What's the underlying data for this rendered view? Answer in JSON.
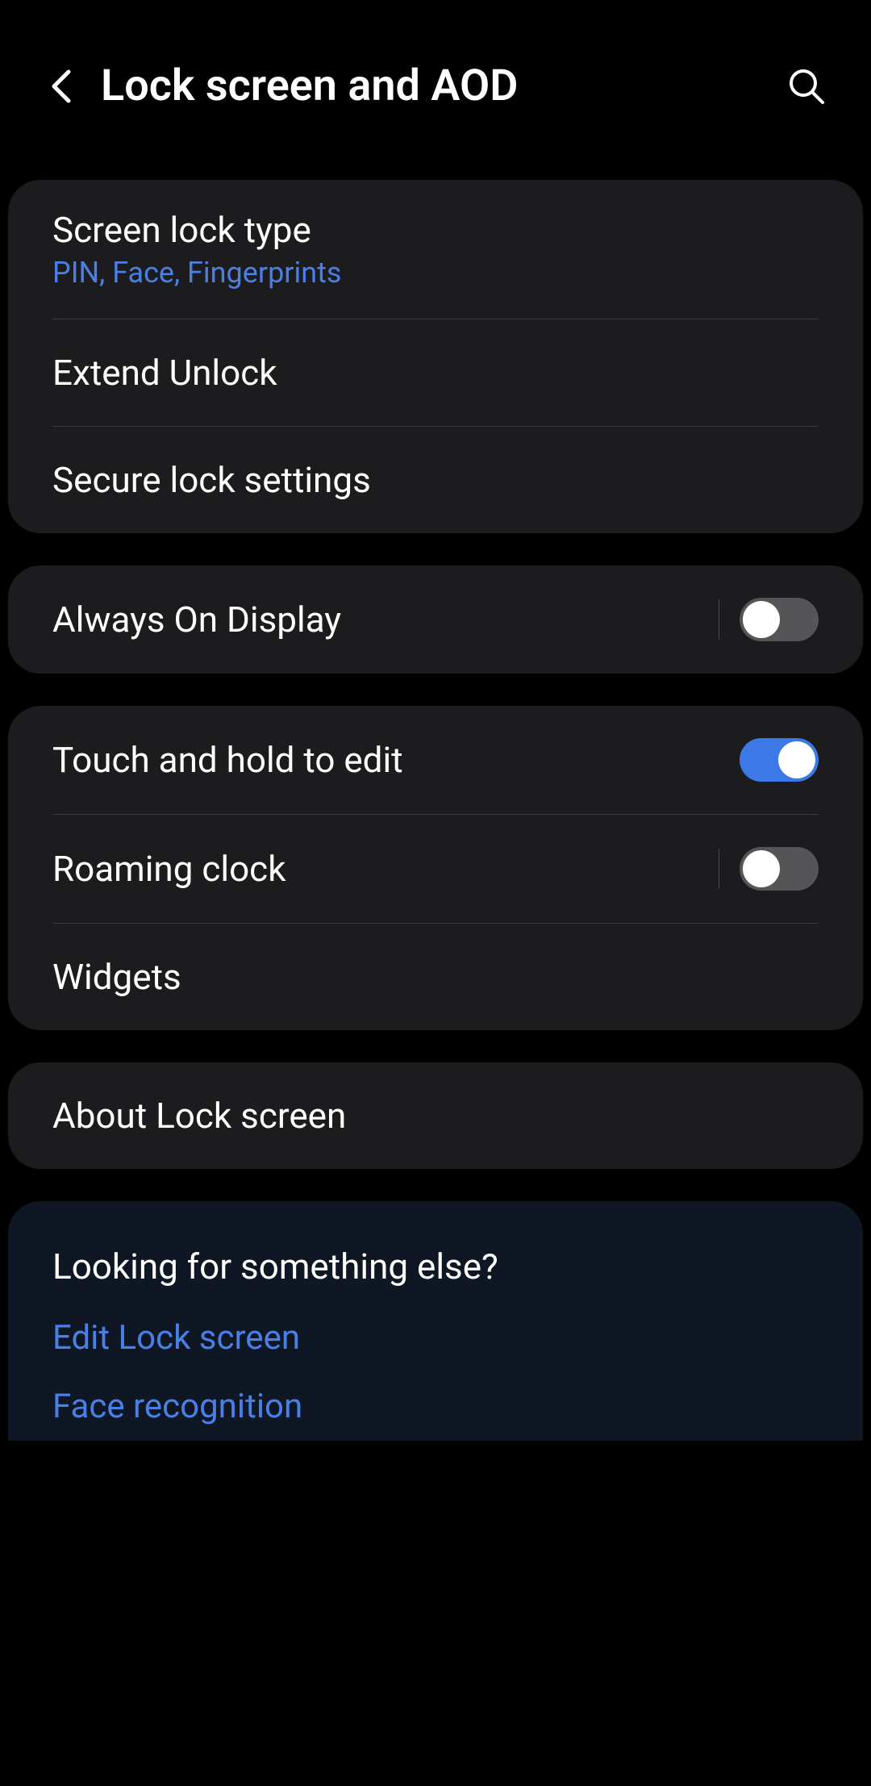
{
  "header": {
    "title": "Lock screen and AOD"
  },
  "group1": {
    "screen_lock_type": {
      "title": "Screen lock type",
      "subtitle": "PIN, Face, Fingerprints"
    },
    "extend_unlock": {
      "title": "Extend Unlock"
    },
    "secure_lock": {
      "title": "Secure lock settings"
    }
  },
  "group2": {
    "aod": {
      "title": "Always On Display",
      "enabled": false
    }
  },
  "group3": {
    "touch_hold": {
      "title": "Touch and hold to edit",
      "enabled": true
    },
    "roaming_clock": {
      "title": "Roaming clock",
      "enabled": false
    },
    "widgets": {
      "title": "Widgets"
    }
  },
  "group4": {
    "about": {
      "title": "About Lock screen"
    }
  },
  "suggestions": {
    "title": "Looking for something else?",
    "links": [
      "Edit Lock screen",
      "Face recognition"
    ]
  }
}
